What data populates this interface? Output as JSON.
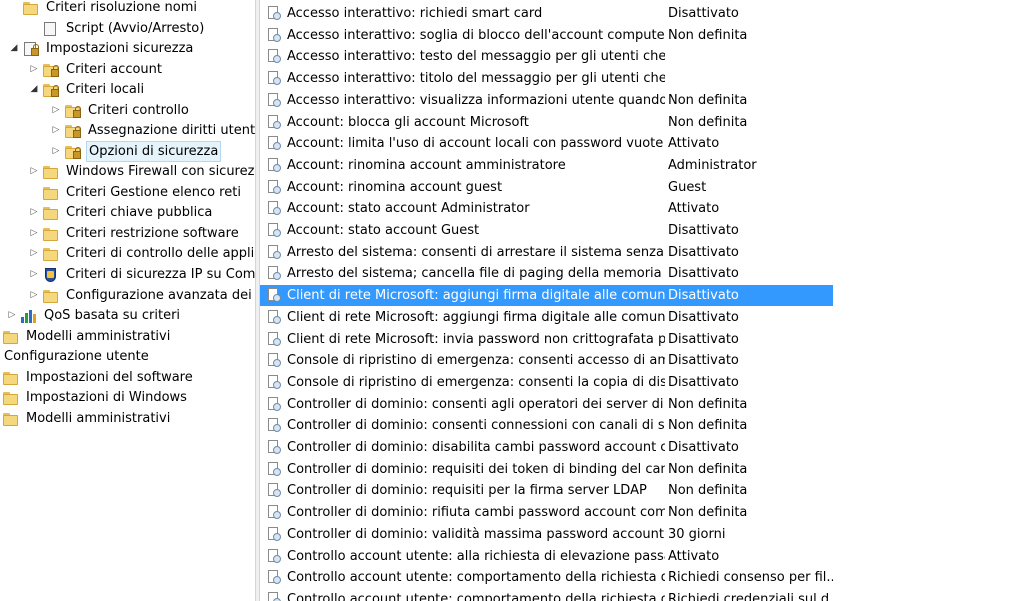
{
  "tree": {
    "items": [
      {
        "label": "Criteri risoluzione nomi",
        "icon": "folder-icon",
        "expander": "",
        "selected": false
      },
      {
        "label": "Script (Avvio/Arresto)",
        "icon": "script-doc-icon",
        "expander": "",
        "selected": false
      },
      {
        "label": "Impostazioni sicurezza",
        "icon": "security-settings-icon",
        "expander": "expanded",
        "selected": false
      },
      {
        "label": "Criteri account",
        "icon": "locked-folder-icon",
        "expander": "collapsed",
        "selected": false
      },
      {
        "label": "Criteri locali",
        "icon": "locked-folder-icon",
        "expander": "expanded",
        "selected": false
      },
      {
        "label": "Criteri controllo",
        "icon": "locked-folder-icon",
        "expander": "collapsed",
        "selected": false
      },
      {
        "label": "Assegnazione diritti utente",
        "icon": "locked-folder-icon",
        "expander": "collapsed",
        "selected": false
      },
      {
        "label": "Opzioni di sicurezza",
        "icon": "locked-folder-icon",
        "expander": "collapsed",
        "selected": true
      },
      {
        "label": "Windows Firewall con sicurezza",
        "icon": "folder-icon",
        "expander": "collapsed",
        "selected": false
      },
      {
        "label": "Criteri Gestione elenco reti",
        "icon": "folder-icon",
        "expander": "",
        "selected": false
      },
      {
        "label": "Criteri chiave pubblica",
        "icon": "folder-icon",
        "expander": "collapsed",
        "selected": false
      },
      {
        "label": "Criteri restrizione software",
        "icon": "folder-icon",
        "expander": "collapsed",
        "selected": false
      },
      {
        "label": "Criteri di controllo delle applica",
        "icon": "folder-icon",
        "expander": "collapsed",
        "selected": false
      },
      {
        "label": "Criteri di sicurezza IP su Compu",
        "icon": "ip-security-icon",
        "expander": "collapsed",
        "selected": false
      },
      {
        "label": "Configurazione avanzata dei cr",
        "icon": "folder-icon",
        "expander": "collapsed",
        "selected": false
      },
      {
        "label": "QoS basata su criteri",
        "icon": "qos-chart-icon",
        "expander": "collapsed",
        "selected": false
      },
      {
        "label": "Modelli amministrativi",
        "icon": "folder-icon",
        "expander": "",
        "selected": false
      },
      {
        "label": "Configurazione utente",
        "icon": "",
        "expander": "",
        "selected": false
      },
      {
        "label": "Impostazioni del software",
        "icon": "folder-icon",
        "expander": "",
        "selected": false
      },
      {
        "label": "Impostazioni di Windows",
        "icon": "folder-icon",
        "expander": "",
        "selected": false
      },
      {
        "label": "Modelli amministrativi",
        "icon": "folder-icon",
        "expander": "",
        "selected": false
      }
    ]
  },
  "policies": {
    "rows": [
      {
        "policy": "Accesso interattivo: richiedi smart card",
        "setting": "Disattivato"
      },
      {
        "policy": "Accesso interattivo: soglia di blocco dell'account computer",
        "setting": "Non definita"
      },
      {
        "policy": "Accesso interattivo: testo del messaggio per gli utenti che te...",
        "setting": ""
      },
      {
        "policy": "Accesso interattivo: titolo del messaggio per gli utenti che t...",
        "setting": ""
      },
      {
        "policy": "Accesso interattivo: visualizza informazioni utente quando l...",
        "setting": "Non definita"
      },
      {
        "policy": "Account: blocca gli account Microsoft",
        "setting": "Non definita"
      },
      {
        "policy": "Account: limita l'uso di account locali con password vuote s...",
        "setting": "Attivato"
      },
      {
        "policy": "Account: rinomina account amministratore",
        "setting": "Administrator"
      },
      {
        "policy": "Account: rinomina account guest",
        "setting": "Guest"
      },
      {
        "policy": "Account: stato account Administrator",
        "setting": "Attivato"
      },
      {
        "policy": "Account: stato account Guest",
        "setting": "Disattivato"
      },
      {
        "policy": "Arresto del sistema: consenti di arrestare il sistema senza eff...",
        "setting": "Disattivato"
      },
      {
        "policy": "Arresto del sistema; cancella file di paging della memoria vir...",
        "setting": "Disattivato"
      },
      {
        "policy": "Client di rete Microsoft: aggiungi firma digitale alle comuni...",
        "setting": "Disattivato"
      },
      {
        "policy": "Client di rete Microsoft: aggiungi firma digitale alle comuni...",
        "setting": "Disattivato"
      },
      {
        "policy": "Client di rete Microsoft: invia password non crittografata per...",
        "setting": "Disattivato"
      },
      {
        "policy": "Console di ripristino di emergenza: consenti accesso di am...",
        "setting": "Disattivato"
      },
      {
        "policy": "Console di ripristino di emergenza: consenti la copia di disc...",
        "setting": "Disattivato"
      },
      {
        "policy": "Controller di dominio: consenti agli operatori dei server di pi...",
        "setting": "Non definita"
      },
      {
        "policy": "Controller di dominio: consenti connessioni con canali di si...",
        "setting": "Non definita"
      },
      {
        "policy": "Controller di dominio: disabilita cambi password account c...",
        "setting": "Disattivato"
      },
      {
        "policy": "Controller di dominio: requisiti dei token di binding del can...",
        "setting": "Non definita"
      },
      {
        "policy": "Controller di dominio: requisiti per la firma server LDAP",
        "setting": "Non definita"
      },
      {
        "policy": "Controller di dominio: rifiuta cambi password account com...",
        "setting": "Non definita"
      },
      {
        "policy": "Controller di dominio: validità massima password account c...",
        "setting": "30 giorni"
      },
      {
        "policy": "Controllo account utente: alla richiesta di elevazione passa a...",
        "setting": "Attivato"
      },
      {
        "policy": "Controllo account utente: comportamento della richiesta di ...",
        "setting": "Richiedi consenso per fil..."
      },
      {
        "policy": "Controllo account utente: comportamento della richiesta di ...",
        "setting": "Richiedi credenziali sul d..."
      }
    ],
    "selected_index": 13
  },
  "colors": {
    "selection": "#3399ff",
    "tree_selection": "#e5f3fb",
    "folder": "#f5d77e"
  }
}
